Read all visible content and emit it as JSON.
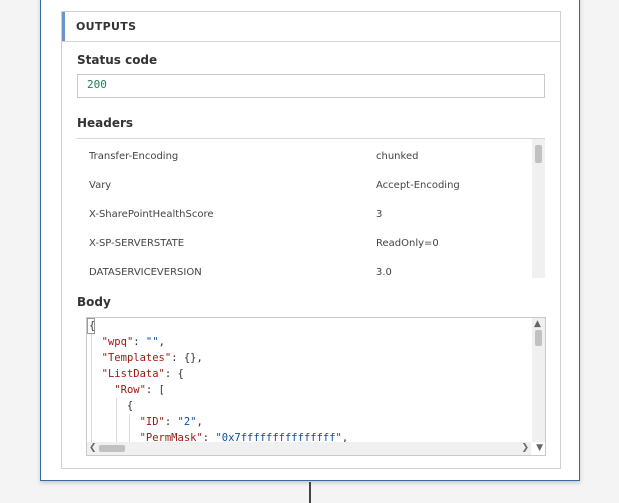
{
  "outputs": {
    "title": "OUTPUTS",
    "status_code": {
      "label": "Status code",
      "value": "200"
    },
    "headers": {
      "label": "Headers",
      "rows": [
        {
          "key": "Transfer-Encoding",
          "value": "chunked"
        },
        {
          "key": "Vary",
          "value": "Accept-Encoding"
        },
        {
          "key": "X-SharePointHealthScore",
          "value": "3"
        },
        {
          "key": "X-SP-SERVERSTATE",
          "value": "ReadOnly=0"
        },
        {
          "key": "DATASERVICEVERSION",
          "value": "3.0"
        }
      ]
    },
    "body": {
      "label": "Body",
      "lines": [
        [
          {
            "t": "p",
            "s": "{"
          }
        ],
        [
          {
            "t": "p",
            "s": "  "
          },
          {
            "t": "key",
            "s": "\"wpq\""
          },
          {
            "t": "p",
            "s": ": "
          },
          {
            "t": "str",
            "s": "\"\""
          },
          {
            "t": "p",
            "s": ","
          }
        ],
        [
          {
            "t": "p",
            "s": "  "
          },
          {
            "t": "key",
            "s": "\"Templates\""
          },
          {
            "t": "p",
            "s": ": {},"
          }
        ],
        [
          {
            "t": "p",
            "s": "  "
          },
          {
            "t": "key",
            "s": "\"ListData\""
          },
          {
            "t": "p",
            "s": ": {"
          }
        ],
        [
          {
            "t": "p",
            "s": "    "
          },
          {
            "t": "key",
            "s": "\"Row\""
          },
          {
            "t": "p",
            "s": ": ["
          }
        ],
        [
          {
            "t": "p",
            "s": "      {"
          }
        ],
        [
          {
            "t": "p",
            "s": "        "
          },
          {
            "t": "key",
            "s": "\"ID\""
          },
          {
            "t": "p",
            "s": ": "
          },
          {
            "t": "str",
            "s": "\"2\""
          },
          {
            "t": "p",
            "s": ","
          }
        ],
        [
          {
            "t": "p",
            "s": "        "
          },
          {
            "t": "key",
            "s": "\"PermMask\""
          },
          {
            "t": "p",
            "s": ": "
          },
          {
            "t": "str",
            "s": "\"0x7fffffffffffffff\""
          },
          {
            "t": "p",
            "s": ","
          }
        ]
      ]
    }
  },
  "icons": {
    "scroll_up": "triangle-up",
    "scroll_down": "triangle-down",
    "scroll_left": "chevron-left",
    "scroll_right": "chevron-right"
  }
}
